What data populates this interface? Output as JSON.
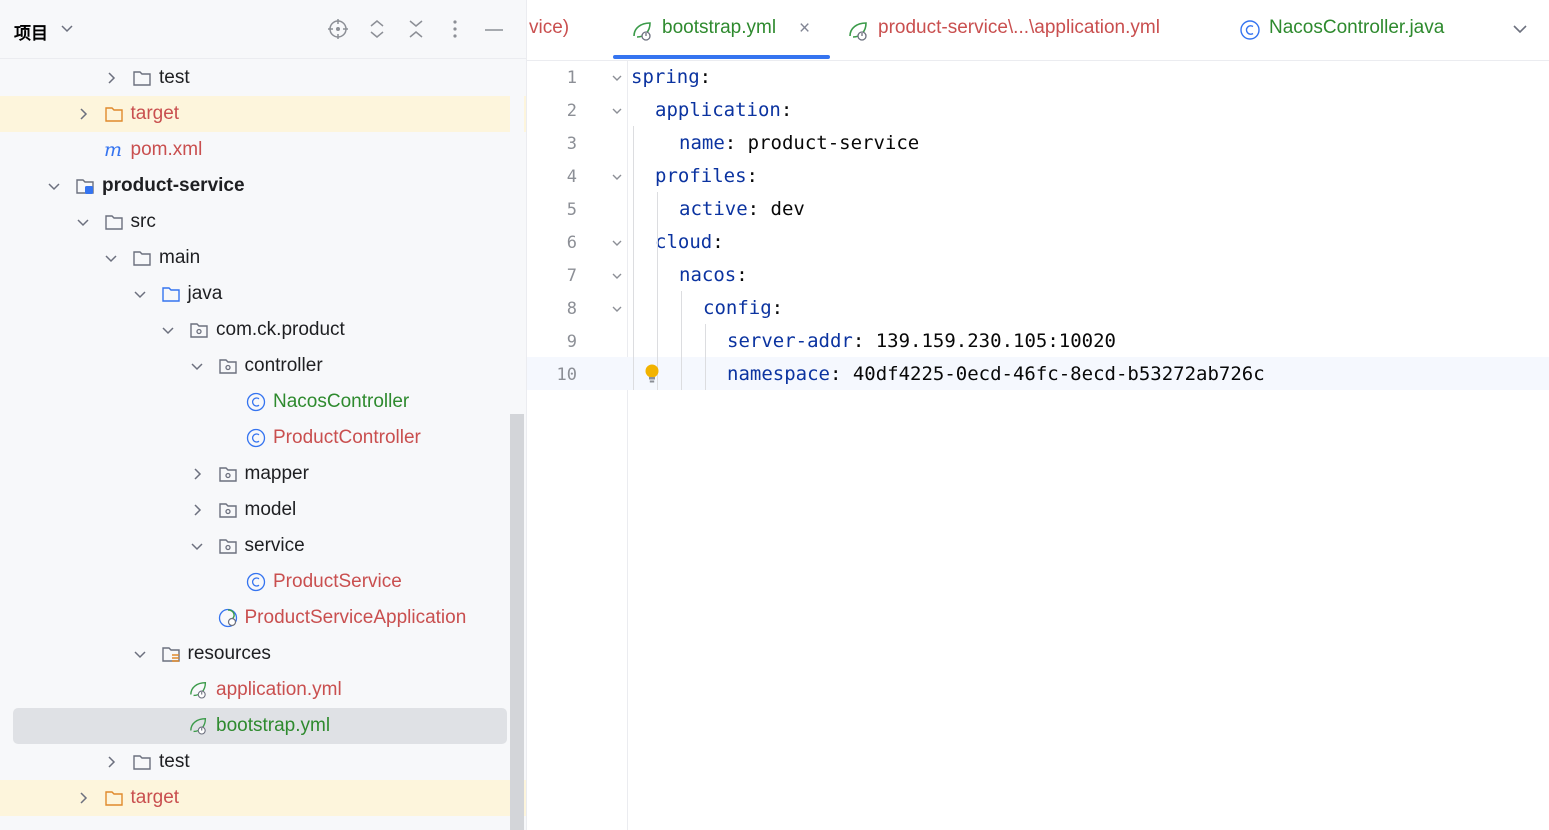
{
  "project_panel": {
    "title": "项目",
    "toolbar_icons": [
      "locate-icon",
      "expand-all-icon",
      "collapse-all-icon",
      "more-icon",
      "minimize-icon"
    ],
    "tree": [
      {
        "label": "test",
        "icon": "folder-icon",
        "expanded": false
      },
      {
        "label": "target",
        "icon": "folder-orange-icon",
        "expanded": false
      },
      {
        "label": "pom.xml",
        "icon": "maven-icon"
      },
      {
        "label": "product-service",
        "icon": "module-icon",
        "expanded": true
      },
      {
        "label": "src",
        "icon": "folder-icon",
        "expanded": true
      },
      {
        "label": "main",
        "icon": "folder-icon",
        "expanded": true
      },
      {
        "label": "java",
        "icon": "source-folder-icon",
        "expanded": true
      },
      {
        "label": "com.ck.product",
        "icon": "package-icon",
        "expanded": true
      },
      {
        "label": "controller",
        "icon": "package-icon",
        "expanded": true
      },
      {
        "label": "NacosController",
        "icon": "class-icon"
      },
      {
        "label": "ProductController",
        "icon": "class-icon"
      },
      {
        "label": "mapper",
        "icon": "package-icon",
        "expanded": false
      },
      {
        "label": "model",
        "icon": "package-icon",
        "expanded": false
      },
      {
        "label": "service",
        "icon": "package-icon",
        "expanded": true
      },
      {
        "label": "ProductService",
        "icon": "class-icon"
      },
      {
        "label": "ProductServiceApplication",
        "icon": "spring-boot-class-icon"
      },
      {
        "label": "resources",
        "icon": "resources-folder-icon",
        "expanded": true
      },
      {
        "label": "application.yml",
        "icon": "spring-yml-icon"
      },
      {
        "label": "bootstrap.yml",
        "icon": "spring-yml-icon",
        "selected": true
      },
      {
        "label": "test",
        "icon": "folder-icon",
        "expanded": false
      },
      {
        "label": "target",
        "icon": "folder-orange-icon",
        "expanded": false
      }
    ]
  },
  "editor": {
    "tabs": [
      {
        "label": "vice)",
        "icon": ""
      },
      {
        "label": "bootstrap.yml",
        "icon": "spring-yml-icon",
        "active": true,
        "close": "×"
      },
      {
        "label": "product-service\\...\\application.yml",
        "icon": "spring-yml-icon"
      },
      {
        "label": "NacosController.java",
        "icon": "class-icon"
      }
    ],
    "tab_overflow_icon": "chevron-down-icon",
    "line_numbers": [
      "1",
      "2",
      "3",
      "4",
      "5",
      "6",
      "7",
      "8",
      "9",
      "10"
    ],
    "lines": [
      {
        "key": "spring",
        "sep": ":",
        "value": ""
      },
      {
        "key": "application",
        "sep": ":",
        "value": ""
      },
      {
        "key": "name",
        "sep": ":",
        "value": " product-service"
      },
      {
        "key": "profiles",
        "sep": ":",
        "value": ""
      },
      {
        "key": "active",
        "sep": ":",
        "value": " dev"
      },
      {
        "key": "cloud",
        "sep": ":",
        "value": ""
      },
      {
        "key": "nacos",
        "sep": ":",
        "value": ""
      },
      {
        "key": "config",
        "sep": ":",
        "value": ""
      },
      {
        "key": "server-addr",
        "sep": ":",
        "value": " 139.159.230.105:10020"
      },
      {
        "key": "namespace",
        "sep": ":",
        "value": " 40df4225-0ecd-46fc-8ecd-b53272ab726c"
      }
    ],
    "current_line": "10",
    "intention_icon": "lightbulb-icon"
  },
  "colors": {
    "key": "#0b33a0",
    "modified_file": "#c94f4f",
    "vcs_added": "#2e8a2e",
    "accent": "#3574f0",
    "excluded_row": "#fdf5dc"
  }
}
